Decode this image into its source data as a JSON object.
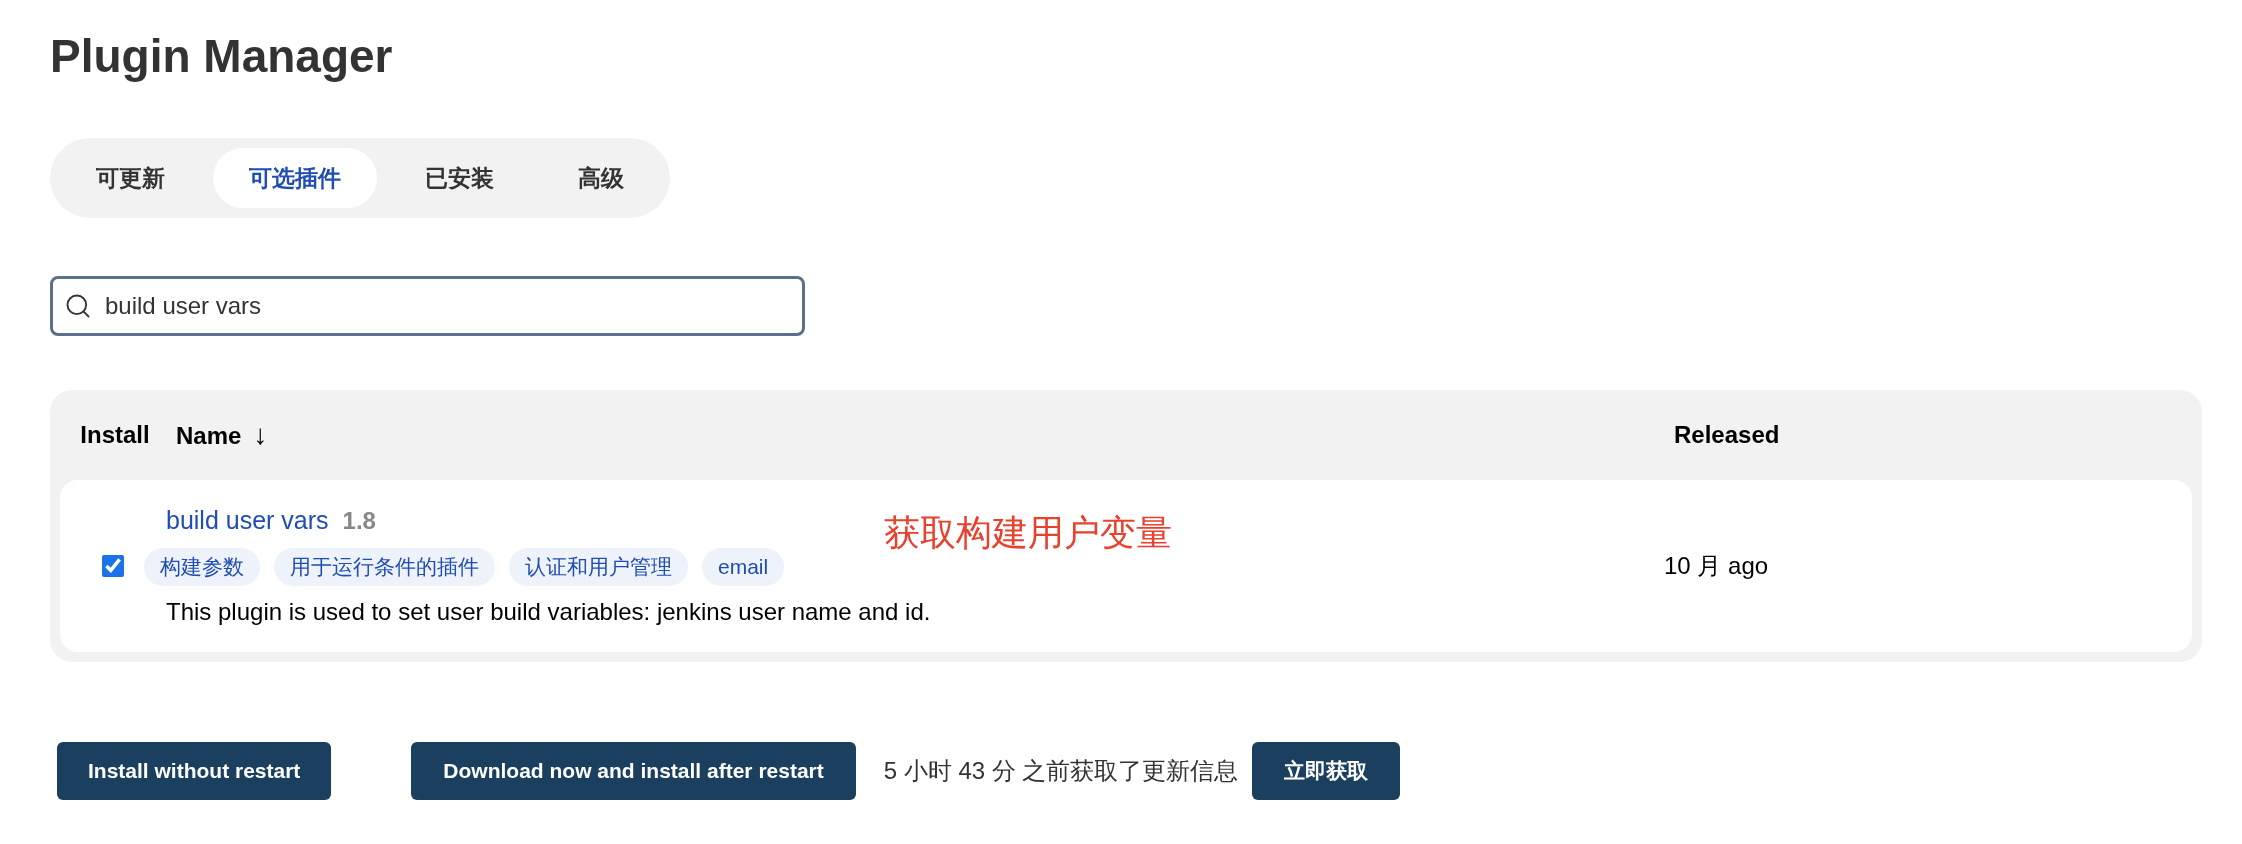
{
  "page_title": "Plugin Manager",
  "tabs": [
    {
      "label": "可更新",
      "selected": false
    },
    {
      "label": "可选插件",
      "selected": true
    },
    {
      "label": "已安装",
      "selected": false
    },
    {
      "label": "高级",
      "selected": false
    }
  ],
  "search": {
    "value": "build user vars"
  },
  "table": {
    "columns": [
      {
        "label": "Install"
      },
      {
        "label": "Name",
        "sort": "↓"
      },
      {
        "label": "Released"
      }
    ],
    "rows": [
      {
        "checked": true,
        "name": "build user vars",
        "version": "1.8",
        "tags": [
          "构建参数",
          "用于运行条件的插件",
          "认证和用户管理",
          "email"
        ],
        "description": "This plugin is used to set user build variables: jenkins user name and id.",
        "released": "10 月 ago",
        "annotation": "获取构建用户变量"
      }
    ]
  },
  "footer": {
    "install_button": "Install without restart",
    "download_button": "Download now and install after restart",
    "update_info": "5 小时 43 分 之前获取了更新信息",
    "fetch_button": "立即获取"
  }
}
